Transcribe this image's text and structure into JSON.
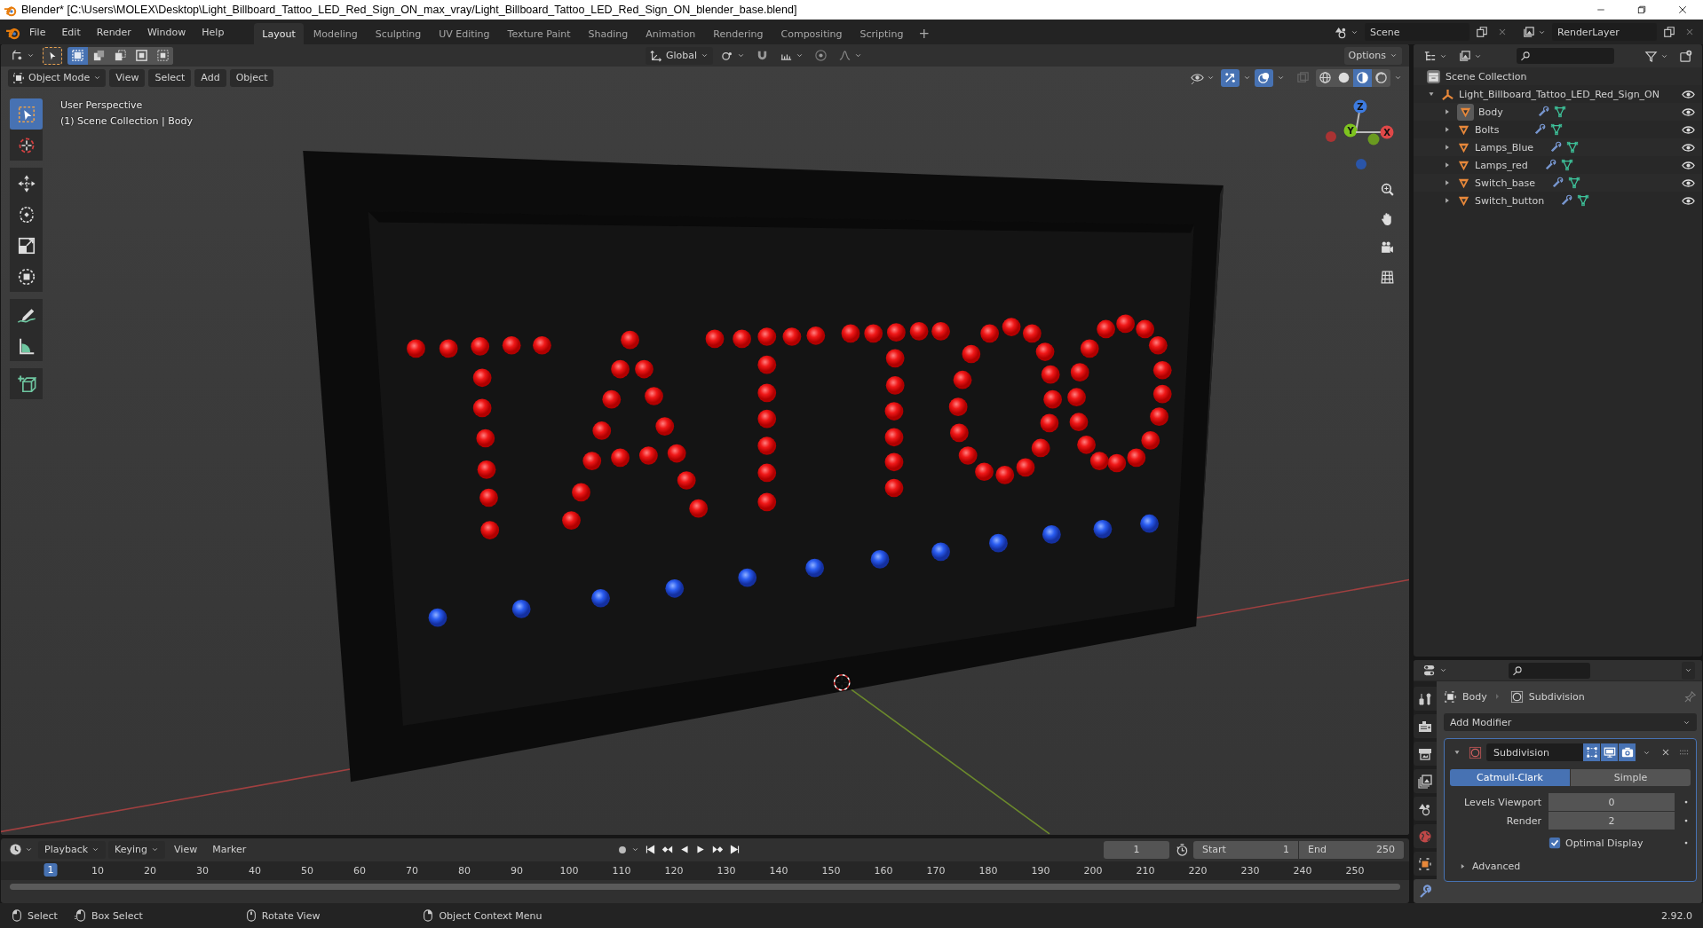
{
  "window": {
    "title": "Blender* [C:\\Users\\MOLEX\\Desktop\\Light_Billboard_Tattoo_LED_Red_Sign_ON_max_vray/Light_Billboard_Tattoo_LED_Red_Sign_ON_blender_base.blend]"
  },
  "menu": [
    "File",
    "Edit",
    "Render",
    "Window",
    "Help"
  ],
  "workspaces": [
    {
      "label": "Layout",
      "selected": true
    },
    {
      "label": "Modeling",
      "selected": false
    },
    {
      "label": "Sculpting",
      "selected": false
    },
    {
      "label": "UV Editing",
      "selected": false
    },
    {
      "label": "Texture Paint",
      "selected": false
    },
    {
      "label": "Shading",
      "selected": false
    },
    {
      "label": "Animation",
      "selected": false
    },
    {
      "label": "Rendering",
      "selected": false
    },
    {
      "label": "Compositing",
      "selected": false
    },
    {
      "label": "Scripting",
      "selected": false
    }
  ],
  "add_workspace": "+",
  "scene": "Scene",
  "view_layer": "RenderLayer",
  "tool_header": {
    "select_modes": [
      {
        "kind": "set",
        "selected": true
      },
      {
        "kind": "extend",
        "selected": false
      },
      {
        "kind": "subtract",
        "selected": false
      },
      {
        "kind": "invert",
        "selected": false
      },
      {
        "kind": "intersect",
        "selected": false
      }
    ],
    "orientation": "Global",
    "options": "Options"
  },
  "viewport": {
    "mode": "Object Mode",
    "menus": [
      "View",
      "Select",
      "Add",
      "Object"
    ],
    "toggles": {
      "gizmos": true,
      "overlays": true,
      "xray": false
    },
    "shading": [
      {
        "kind": "wireframe",
        "selected": false
      },
      {
        "kind": "solid",
        "selected": false
      },
      {
        "kind": "material",
        "selected": true
      },
      {
        "kind": "rendered",
        "selected": false
      }
    ],
    "info": [
      "User Perspective",
      "(1) Scene Collection | Body"
    ],
    "tools": [
      {
        "kind": "select",
        "selected": true
      },
      {
        "kind": "cursor",
        "selected": false
      },
      {
        "kind": "move",
        "selected": false
      },
      {
        "kind": "rotate",
        "selected": false
      },
      {
        "kind": "scale",
        "selected": false
      },
      {
        "kind": "transform",
        "selected": false
      },
      {
        "kind": "annotate",
        "selected": false
      },
      {
        "kind": "measure",
        "selected": false
      },
      {
        "kind": "add_cube",
        "selected": false
      }
    ],
    "gizmo_axes": [
      "Z",
      "Y",
      "X"
    ]
  },
  "outliner": {
    "root": "Scene Collection",
    "collection": {
      "label": "Light_Billboard_Tattoo_LED_Red_Sign_ON",
      "expanded": true,
      "children": [
        {
          "label": "Body",
          "expanded": false,
          "selected": true
        },
        {
          "label": "Bolts",
          "expanded": false,
          "selected": false
        },
        {
          "label": "Lamps_Blue",
          "expanded": false,
          "selected": false
        },
        {
          "label": "Lamps_red",
          "expanded": false,
          "selected": false
        },
        {
          "label": "Switch_base",
          "expanded": false,
          "selected": false
        },
        {
          "label": "Switch_button",
          "expanded": false,
          "selected": false
        }
      ]
    }
  },
  "properties": {
    "tabs": [
      {
        "kind": "tool",
        "selected": false
      },
      {
        "kind": "render",
        "selected": false
      },
      {
        "kind": "output",
        "selected": false
      },
      {
        "kind": "view_layer",
        "selected": false
      },
      {
        "kind": "scene",
        "selected": false
      },
      {
        "kind": "world",
        "selected": false
      },
      {
        "kind": "object",
        "selected": false
      },
      {
        "kind": "modifiers",
        "selected": true
      }
    ],
    "breadcrumb": [
      "Body",
      "Subdivision"
    ],
    "add_modifier": "Add Modifier",
    "modifier": {
      "name": "Subdivision",
      "expanded": true,
      "types": [
        {
          "label": "Catmull-Clark",
          "selected": true
        },
        {
          "label": "Simple",
          "selected": false
        }
      ],
      "fields": [
        {
          "label": "Levels Viewport",
          "value": "0"
        },
        {
          "label": "Render",
          "value": "2"
        }
      ],
      "optimal_display": {
        "label": "Optimal Display",
        "checked": true
      },
      "advanced": {
        "label": "Advanced",
        "expanded": false
      }
    }
  },
  "timeline": {
    "menus": [
      {
        "label": "Playback",
        "dropdown": true
      },
      {
        "label": "Keying",
        "dropdown": true
      },
      {
        "label": "View",
        "dropdown": false
      },
      {
        "label": "Marker",
        "dropdown": false
      }
    ],
    "current_frame": "1",
    "start": {
      "label": "Start",
      "value": "1"
    },
    "end": {
      "label": "End",
      "value": "250"
    },
    "ticks": [
      {
        "label": "1",
        "selected": true
      },
      {
        "label": "10",
        "selected": false
      },
      {
        "label": "20",
        "selected": false
      },
      {
        "label": "30",
        "selected": false
      },
      {
        "label": "40",
        "selected": false
      },
      {
        "label": "50",
        "selected": false
      },
      {
        "label": "60",
        "selected": false
      },
      {
        "label": "70",
        "selected": false
      },
      {
        "label": "80",
        "selected": false
      },
      {
        "label": "90",
        "selected": false
      },
      {
        "label": "100",
        "selected": false
      },
      {
        "label": "110",
        "selected": false
      },
      {
        "label": "120",
        "selected": false
      },
      {
        "label": "130",
        "selected": false
      },
      {
        "label": "140",
        "selected": false
      },
      {
        "label": "150",
        "selected": false
      },
      {
        "label": "160",
        "selected": false
      },
      {
        "label": "170",
        "selected": false
      },
      {
        "label": "180",
        "selected": false
      },
      {
        "label": "190",
        "selected": false
      },
      {
        "label": "200",
        "selected": false
      },
      {
        "label": "210",
        "selected": false
      },
      {
        "label": "220",
        "selected": false
      },
      {
        "label": "230",
        "selected": false
      },
      {
        "label": "240",
        "selected": false
      },
      {
        "label": "250",
        "selected": false
      }
    ]
  },
  "status_bar": {
    "hints": [
      {
        "label": "Select",
        "kind": "left"
      },
      {
        "label": "Box Select",
        "kind": "drag"
      },
      {
        "label": "Rotate View",
        "kind": "middle"
      },
      {
        "label": "Object Context Menu",
        "kind": "right"
      }
    ],
    "version": "2.92.0"
  }
}
